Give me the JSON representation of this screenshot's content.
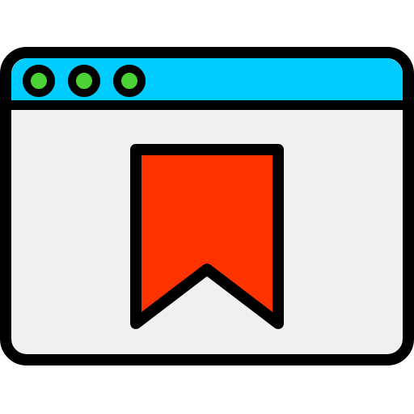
{
  "icon": {
    "name": "browser-bookmark-icon",
    "window": {
      "frame_color": "#000000",
      "titlebar_color": "#00CCFF",
      "body_color": "#F0F0F0",
      "dot_color": "#4CD137",
      "dot_count": 3
    },
    "bookmark": {
      "name": "bookmark-ribbon-icon",
      "fill_color": "#FF3300",
      "stroke_color": "#000000"
    }
  }
}
